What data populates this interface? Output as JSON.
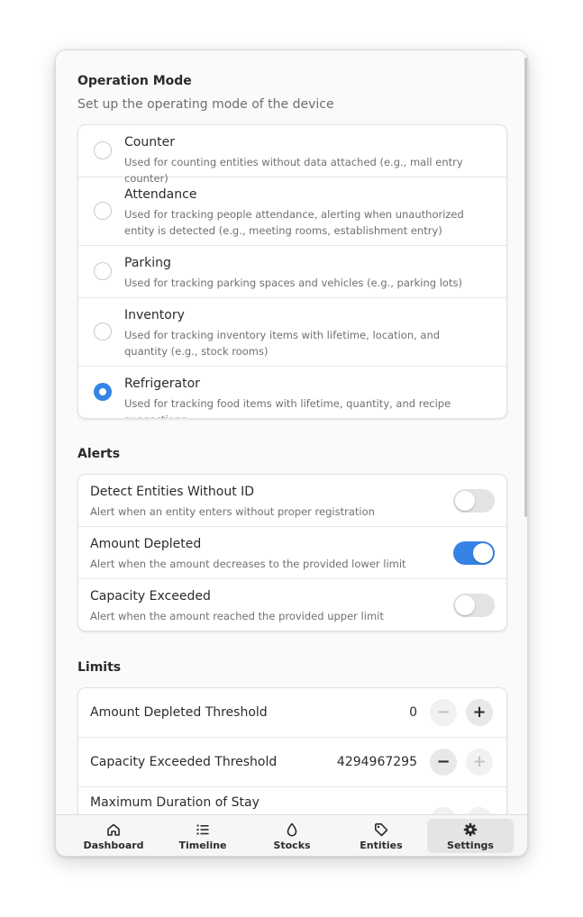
{
  "operation_mode": {
    "title": "Operation Mode",
    "subtitle": "Set up the operating mode of the device",
    "options": [
      {
        "title": "Counter",
        "description": "Used for counting entities without data attached (e.g., mall entry counter)",
        "selected": false
      },
      {
        "title": "Attendance",
        "description": "Used for tracking people attendance, alerting when unauthorized entity is detected (e.g., meeting rooms, establishment entry)",
        "selected": false
      },
      {
        "title": "Parking",
        "description": "Used for tracking parking spaces and vehicles (e.g., parking lots)",
        "selected": false
      },
      {
        "title": "Inventory",
        "description": "Used for tracking inventory items with lifetime, location, and quantity (e.g., stock rooms)",
        "selected": false
      },
      {
        "title": "Refrigerator",
        "description": "Used for tracking food items with lifetime, quantity, and recipe suggestions",
        "selected": true
      }
    ]
  },
  "alerts": {
    "title": "Alerts",
    "items": [
      {
        "title": "Detect Entities Without ID",
        "description": "Alert when an entity enters without proper registration",
        "enabled": false
      },
      {
        "title": "Amount Depleted",
        "description": "Alert when the amount decreases to the provided lower limit",
        "enabled": true
      },
      {
        "title": "Capacity Exceeded",
        "description": "Alert when the amount reached the provided upper limit",
        "enabled": false
      }
    ]
  },
  "limits": {
    "title": "Limits",
    "items": [
      {
        "label": "Amount Depleted Threshold",
        "value": "0",
        "minus": "−",
        "plus": "+"
      },
      {
        "label": "Capacity Exceeded Threshold",
        "value": "4294967295",
        "minus": "−",
        "plus": "+"
      },
      {
        "label": "Maximum Duration of Stay",
        "value": "",
        "minus": "−",
        "plus": "+"
      }
    ]
  },
  "nav": {
    "items": [
      {
        "label": "Dashboard",
        "icon": "home-icon",
        "active": false
      },
      {
        "label": "Timeline",
        "icon": "list-icon",
        "active": false
      },
      {
        "label": "Stocks",
        "icon": "drop-icon",
        "active": false
      },
      {
        "label": "Entities",
        "icon": "tag-icon",
        "active": false
      },
      {
        "label": "Settings",
        "icon": "gear-icon",
        "active": true
      }
    ]
  },
  "colors": {
    "accent": "#3584e4",
    "background": "#fafafa"
  }
}
